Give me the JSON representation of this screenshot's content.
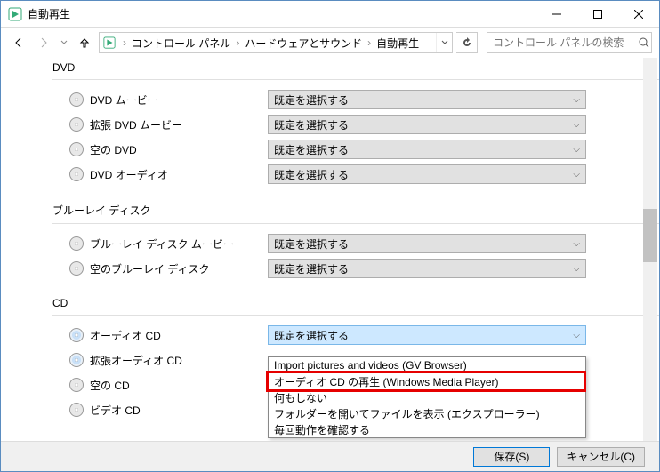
{
  "window": {
    "title": "自動再生"
  },
  "breadcrumb": {
    "segments": [
      "コントロール パネル",
      "ハードウェアとサウンド",
      "自動再生"
    ]
  },
  "search": {
    "placeholder": "コントロール パネルの検索"
  },
  "sections": [
    {
      "name": "DVD",
      "items": [
        {
          "label": "DVD ムービー",
          "icon": "disc-dvd",
          "value": "既定を選択する"
        },
        {
          "label": "拡張 DVD ムービー",
          "icon": "disc-dvd",
          "value": "既定を選択する"
        },
        {
          "label": "空の DVD",
          "icon": "disc-blank",
          "value": "既定を選択する"
        },
        {
          "label": "DVD オーディオ",
          "icon": "disc-dvd",
          "value": "既定を選択する"
        }
      ]
    },
    {
      "name": "ブルーレイ ディスク",
      "items": [
        {
          "label": "ブルーレイ ディスク ムービー",
          "icon": "disc-dvd",
          "value": "既定を選択する"
        },
        {
          "label": "空のブルーレイ ディスク",
          "icon": "disc-blank",
          "value": "既定を選択する"
        }
      ]
    },
    {
      "name": "CD",
      "items": [
        {
          "label": "オーディオ CD",
          "icon": "disc-cd",
          "value": "既定を選択する",
          "focused": true
        },
        {
          "label": "拡張オーディオ CD",
          "icon": "disc-cd",
          "value": ""
        },
        {
          "label": "空の CD",
          "icon": "disc-blank",
          "value": ""
        },
        {
          "label": "ビデオ CD",
          "icon": "disc-dvd",
          "value": ""
        }
      ]
    }
  ],
  "dropdown": {
    "options": [
      "Import pictures and videos (GV Browser)",
      "オーディオ CD の再生 (Windows Media Player)",
      "何もしない",
      "フォルダーを開いてファイルを表示 (エクスプローラー)",
      "毎回動作を確認する"
    ],
    "highlighted_index": 1
  },
  "footer": {
    "save": "保存(S)",
    "cancel": "キャンセル(C)"
  }
}
